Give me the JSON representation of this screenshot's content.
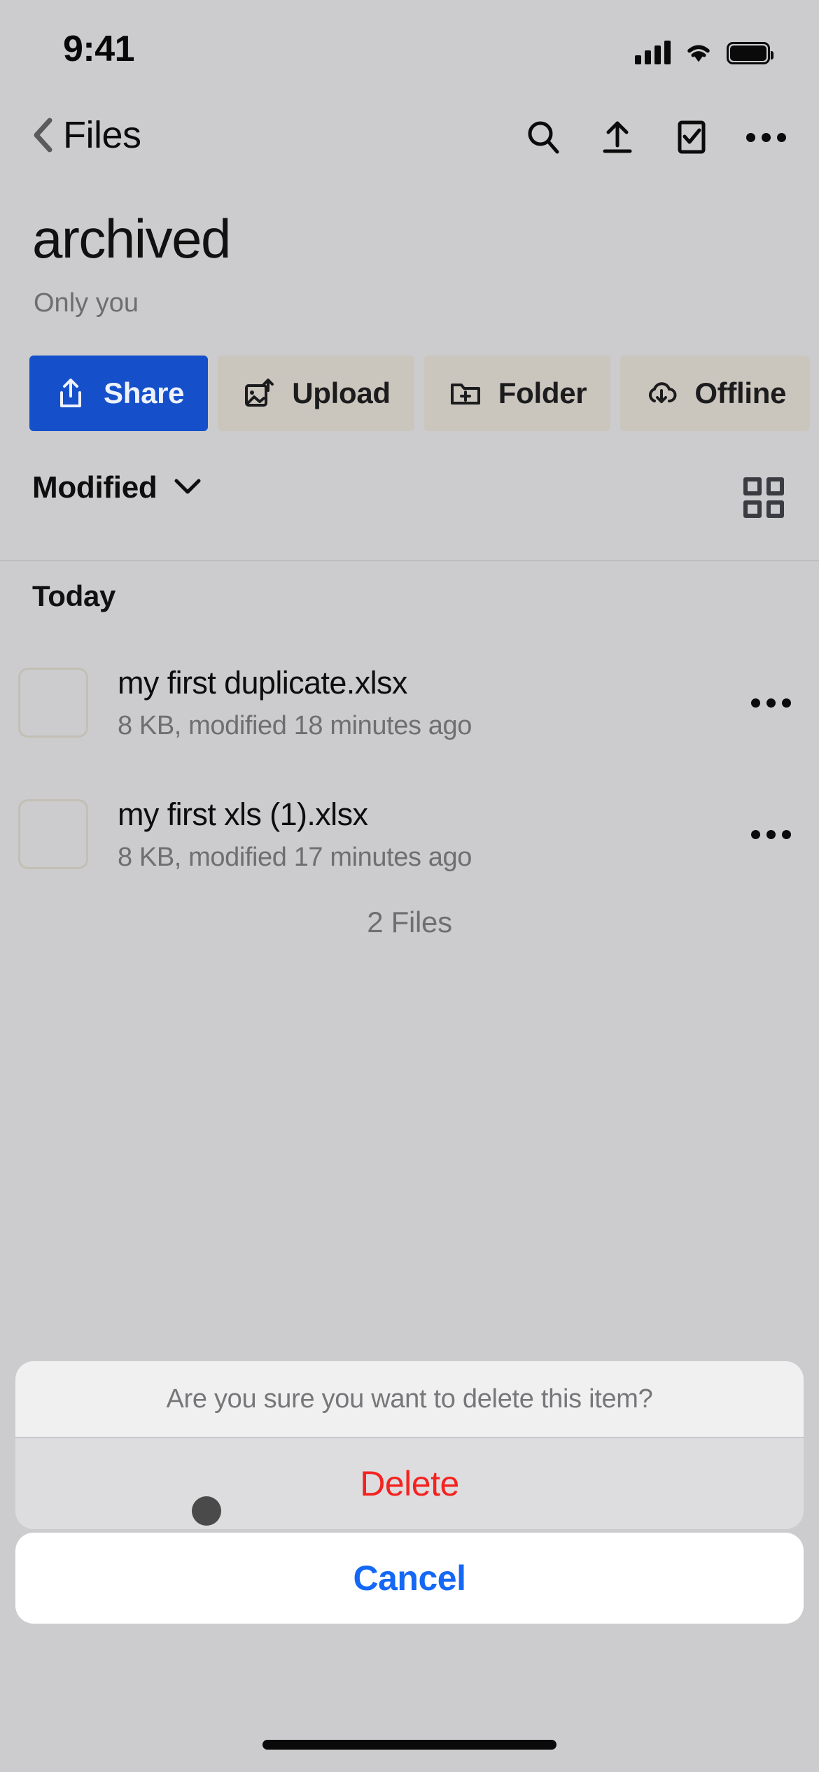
{
  "status_bar": {
    "time": "9:41",
    "icons": [
      "cellular-signal-icon",
      "wifi-icon",
      "battery-icon"
    ]
  },
  "nav_bar": {
    "back_label": "Files",
    "back_icon": "chevron-left-icon",
    "actions": [
      {
        "name": "search-icon"
      },
      {
        "name": "upload-icon"
      },
      {
        "name": "select-checkbox-icon"
      },
      {
        "name": "more-options-icon"
      }
    ]
  },
  "header": {
    "title": "archived",
    "subtitle": "Only you"
  },
  "action_chips": [
    {
      "label": "Share",
      "icon": "share-icon",
      "active": true
    },
    {
      "label": "Upload",
      "icon": "upload-image-icon",
      "active": false
    },
    {
      "label": "Folder",
      "icon": "new-folder-icon",
      "active": false
    },
    {
      "label": "Offline",
      "icon": "offline-cloud-icon",
      "active": false
    }
  ],
  "sort_bar": {
    "sort_label": "Modified",
    "sort_chevron": "chevron-down-icon",
    "view_toggle_icon": "grid-view-icon"
  },
  "file_list": {
    "section_title": "Today",
    "items": [
      {
        "name": "my first duplicate.xlsx",
        "meta": "8 KB, modified 18 minutes ago",
        "checkbox": "unchecked",
        "more_icon": "more-options-icon"
      },
      {
        "name": "my first xls (1).xlsx",
        "meta": "8 KB, modified 17 minutes ago",
        "checkbox": "unchecked",
        "more_icon": "more-options-icon"
      }
    ],
    "count_note": "2 Files"
  },
  "action_sheet": {
    "message": "Are you sure you want to delete this item?",
    "delete_label": "Delete",
    "cancel_label": "Cancel"
  },
  "colors": {
    "background": "#ccccce",
    "accent_blue": "#1550ca",
    "chip_inactive": "#cbc6bd",
    "destructive_red": "#f4231f",
    "cancel_blue": "#1468f5",
    "muted_text": "#6f6f72"
  }
}
